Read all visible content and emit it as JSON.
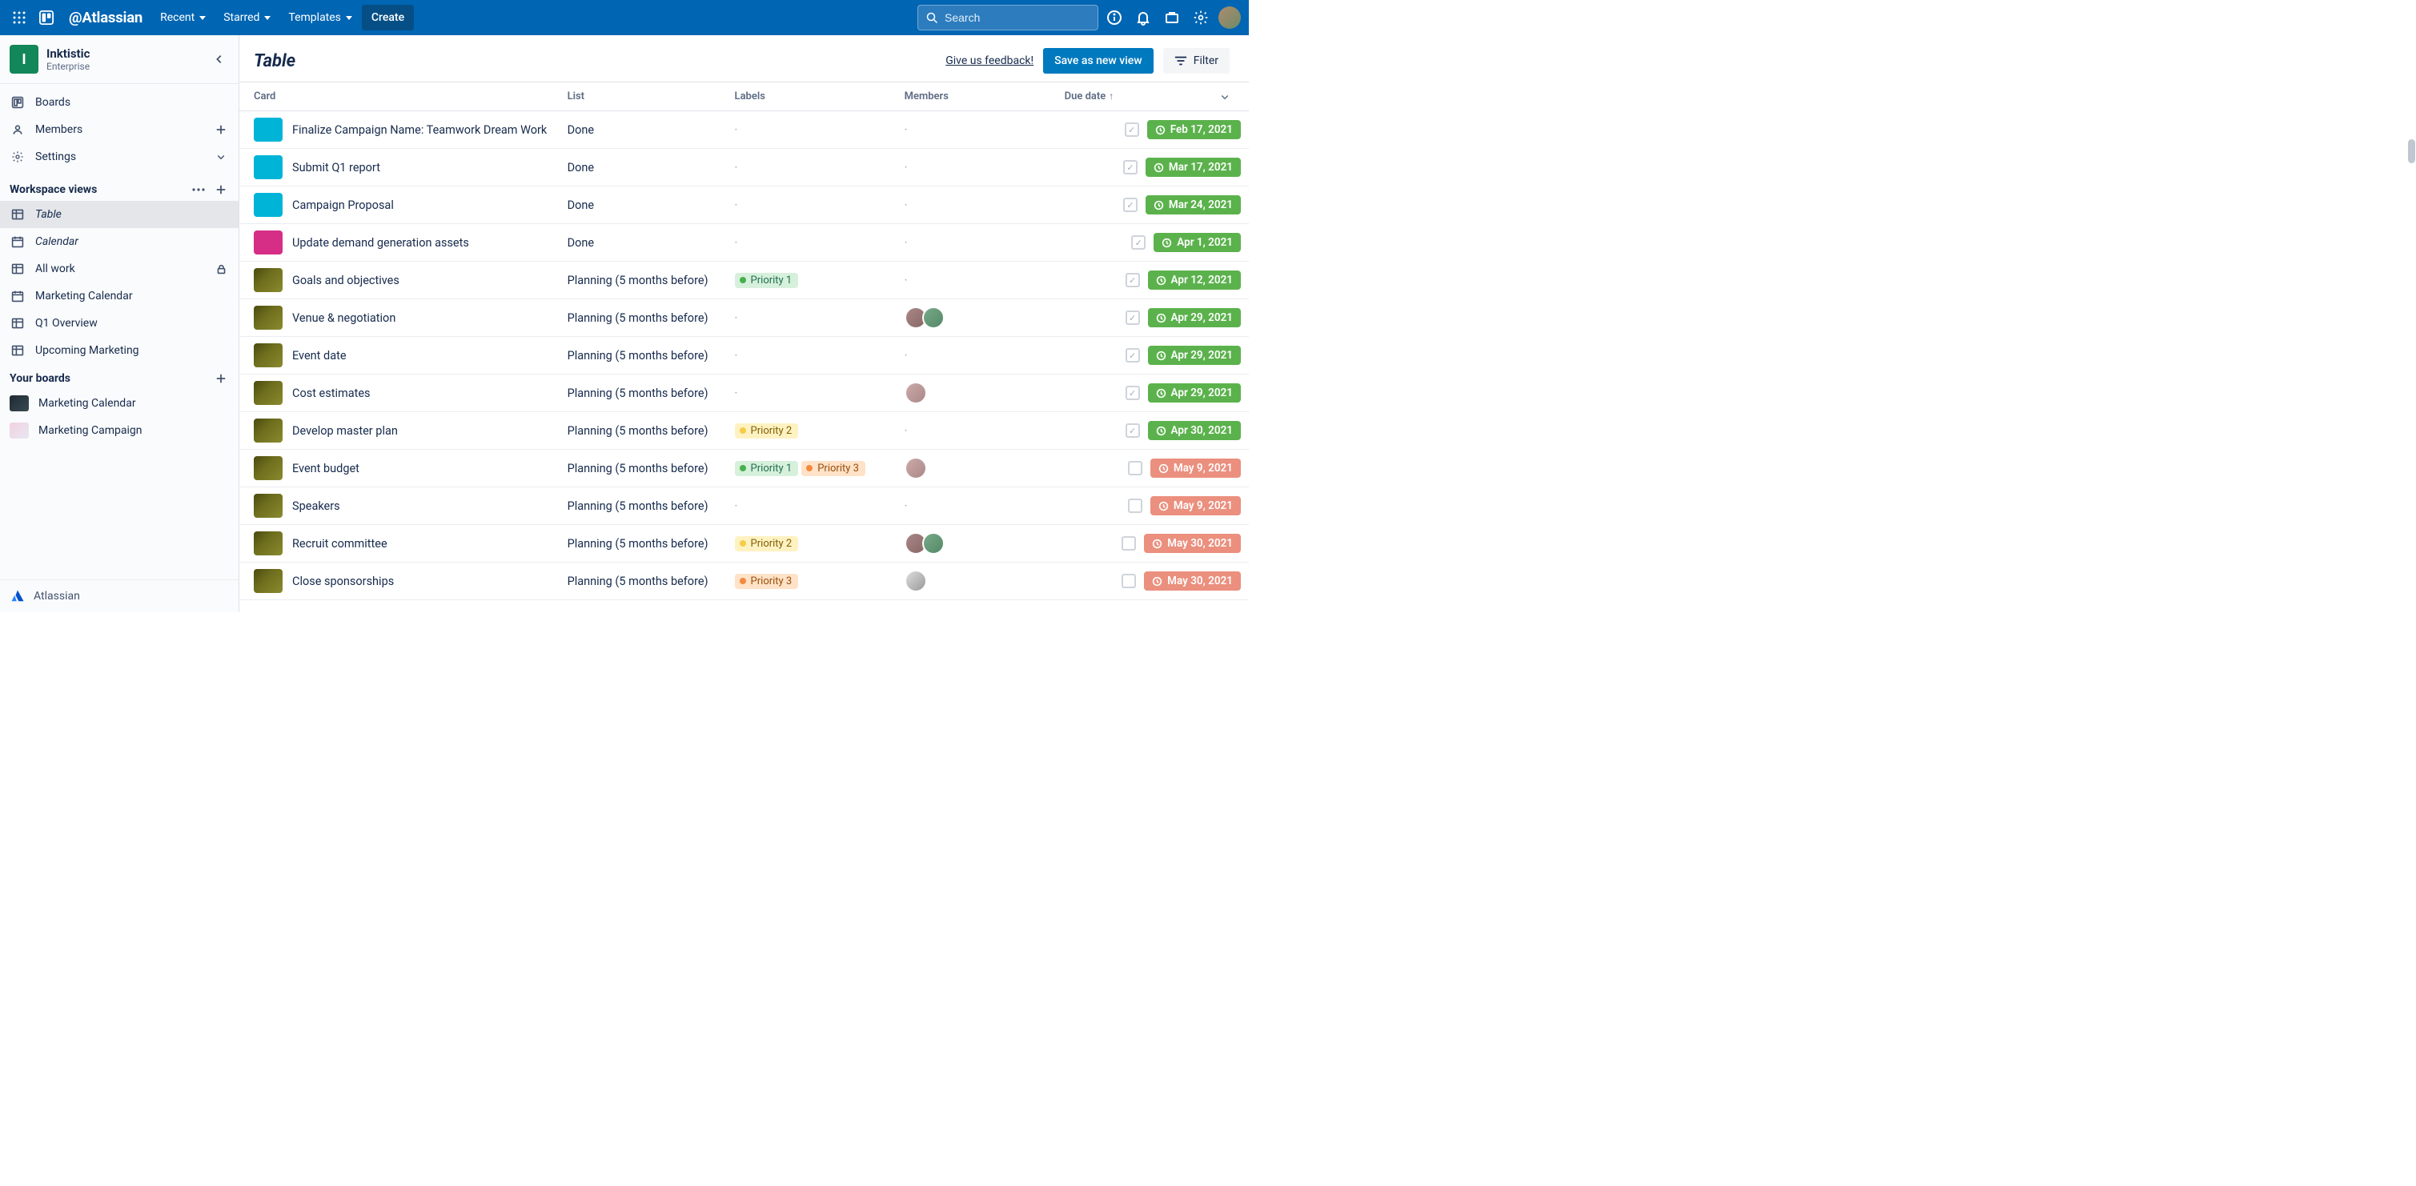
{
  "topbar": {
    "brand": "Atlassian",
    "menu": {
      "recent": "Recent",
      "starred": "Starred",
      "templates": "Templates",
      "create": "Create"
    },
    "search_placeholder": "Search"
  },
  "workspace": {
    "initial": "I",
    "name": "Inktistic",
    "plan": "Enterprise"
  },
  "sidebar": {
    "primary": {
      "boards": "Boards",
      "members": "Members",
      "settings": "Settings"
    },
    "views_header": "Workspace views",
    "views": [
      {
        "label": "Table",
        "icon": "table",
        "active": true,
        "italic": true
      },
      {
        "label": "Calendar",
        "icon": "calendar",
        "active": false,
        "italic": true
      },
      {
        "label": "All work",
        "icon": "table",
        "active": false,
        "locked": true
      },
      {
        "label": "Marketing Calendar",
        "icon": "calendar",
        "active": false
      },
      {
        "label": "Q1 Overview",
        "icon": "table",
        "active": false
      },
      {
        "label": "Upcoming Marketing",
        "icon": "table",
        "active": false
      }
    ],
    "boards_header": "Your boards",
    "boards": [
      {
        "label": "Marketing Calendar",
        "swatch": "bs-dark"
      },
      {
        "label": "Marketing Campaign",
        "swatch": "bs-pink"
      }
    ],
    "footer": "Atlassian"
  },
  "main": {
    "title": "Table",
    "feedback": "Give us feedback!",
    "save_view": "Save as new view",
    "filter": "Filter"
  },
  "table": {
    "columns": {
      "card": "Card",
      "list": "List",
      "labels": "Labels",
      "members": "Members",
      "due": "Due date"
    },
    "sort_column": "due",
    "sort_dir": "asc",
    "labels_palette": {
      "Priority 1": "green",
      "Priority 2": "yellow",
      "Priority 3": "orange"
    },
    "rows": [
      {
        "swatch": "cs-teal",
        "card": "Finalize Campaign Name: Teamwork Dream Work",
        "list": "Done",
        "labels": [],
        "members": [],
        "due": "Feb 17, 2021",
        "due_color": "green",
        "checked": true
      },
      {
        "swatch": "cs-teal",
        "card": "Submit Q1 report",
        "list": "Done",
        "labels": [],
        "members": [],
        "due": "Mar 17, 2021",
        "due_color": "green",
        "checked": true
      },
      {
        "swatch": "cs-teal",
        "card": "Campaign Proposal",
        "list": "Done",
        "labels": [],
        "members": [],
        "due": "Mar 24, 2021",
        "due_color": "green",
        "checked": true
      },
      {
        "swatch": "cs-pink",
        "card": "Update demand generation assets",
        "list": "Done",
        "labels": [],
        "members": [],
        "due": "Apr 1, 2021",
        "due_color": "green",
        "checked": true
      },
      {
        "swatch": "cs-olive",
        "card": "Goals and objectives",
        "list": "Planning (5 months before)",
        "labels": [
          "Priority 1"
        ],
        "members": [],
        "due": "Apr 12, 2021",
        "due_color": "green",
        "checked": true
      },
      {
        "swatch": "cs-olive",
        "card": "Venue & negotiation",
        "list": "Planning (5 months before)",
        "labels": [],
        "members": [
          "av1",
          "av2"
        ],
        "due": "Apr 29, 2021",
        "due_color": "green",
        "checked": true
      },
      {
        "swatch": "cs-olive",
        "card": "Event date",
        "list": "Planning (5 months before)",
        "labels": [],
        "members": [],
        "due": "Apr 29, 2021",
        "due_color": "green",
        "checked": true
      },
      {
        "swatch": "cs-olive",
        "card": "Cost estimates",
        "list": "Planning (5 months before)",
        "labels": [],
        "members": [
          "av3"
        ],
        "due": "Apr 29, 2021",
        "due_color": "green",
        "checked": true
      },
      {
        "swatch": "cs-olive",
        "card": "Develop master plan",
        "list": "Planning (5 months before)",
        "labels": [
          "Priority 2"
        ],
        "members": [],
        "due": "Apr 30, 2021",
        "due_color": "green",
        "checked": true
      },
      {
        "swatch": "cs-olive",
        "card": "Event budget",
        "list": "Planning (5 months before)",
        "labels": [
          "Priority 1",
          "Priority 3"
        ],
        "members": [
          "av3"
        ],
        "due": "May 9, 2021",
        "due_color": "red",
        "checked": false
      },
      {
        "swatch": "cs-olive",
        "card": "Speakers",
        "list": "Planning (5 months before)",
        "labels": [],
        "members": [],
        "due": "May 9, 2021",
        "due_color": "red",
        "checked": false
      },
      {
        "swatch": "cs-olive",
        "card": "Recruit committee",
        "list": "Planning (5 months before)",
        "labels": [
          "Priority 2"
        ],
        "members": [
          "av1",
          "av2"
        ],
        "due": "May 30, 2021",
        "due_color": "red",
        "checked": false
      },
      {
        "swatch": "cs-olive",
        "card": "Close sponsorships",
        "list": "Planning (5 months before)",
        "labels": [
          "Priority 3"
        ],
        "members": [
          "av4"
        ],
        "due": "May 30, 2021",
        "due_color": "red",
        "checked": false
      }
    ]
  }
}
